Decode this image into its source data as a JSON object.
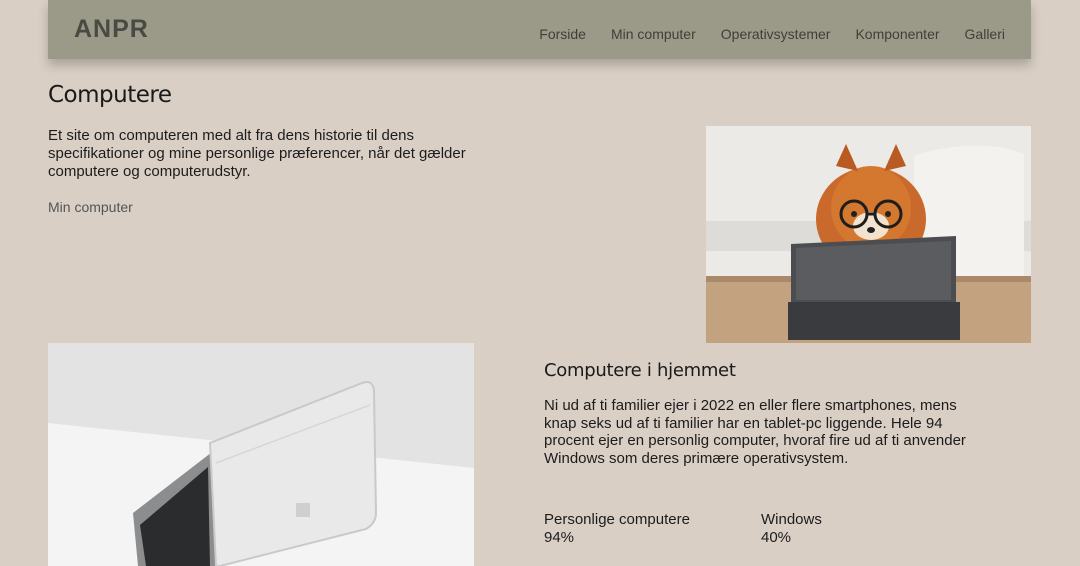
{
  "nav": {
    "logo": "ANPR",
    "links": [
      "Forside",
      "Min computer",
      "Operativsystemer",
      "Komponenter",
      "Galleri"
    ]
  },
  "hero": {
    "title": "Computere",
    "text": "Et site om computeren med alt fra dens historie til dens specifikationer og mine personlige præferencer, når det gælder computere og computerudstyr.",
    "link": "Min computer"
  },
  "section": {
    "title": "Computere i hjemmet",
    "text": "Ni ud af ti familier ejer i 2022 en eller flere smartphones, mens knap seks ud af ti familier har en tablet-pc liggende. Hele 94 procent ejer en personlig computer, hvoraf fire ud af ti anvender Windows som deres primære operativsystem.",
    "stats": [
      {
        "label": "Personlige computere",
        "value": "94%"
      },
      {
        "label": "Windows",
        "value": "40%"
      }
    ]
  },
  "colors": {
    "background": "#d9cfc5",
    "navbar": "#9b9a89"
  }
}
